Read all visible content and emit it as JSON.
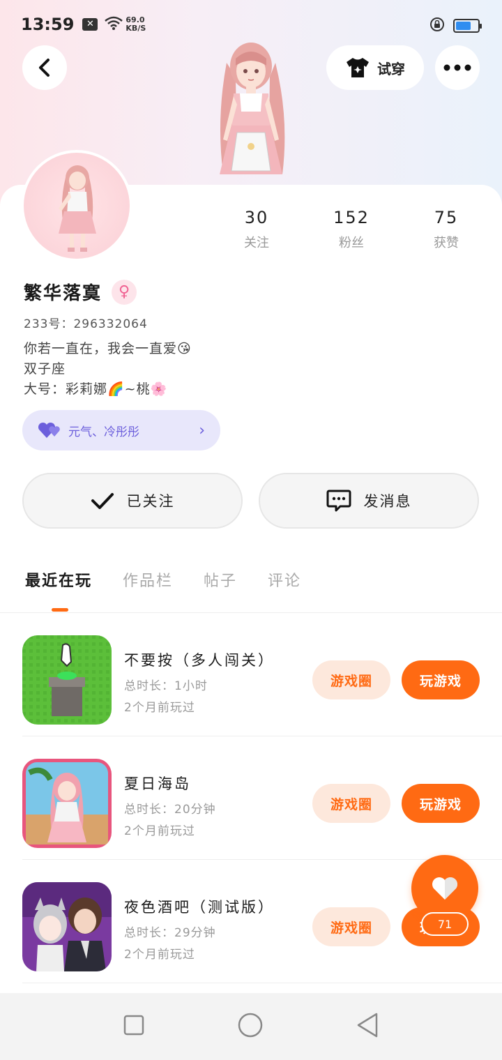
{
  "status_bar": {
    "time": "13:59",
    "notification_icon": "x-box-icon",
    "speed_value": "69.0",
    "speed_unit": "KB/S",
    "battery_level": 0.7,
    "battery_color": "#2f8df0"
  },
  "header": {
    "try_on_label": "试穿"
  },
  "profile": {
    "stats": [
      {
        "value": "30",
        "label": "关注"
      },
      {
        "value": "152",
        "label": "粉丝"
      },
      {
        "value": "75",
        "label": "获赞"
      }
    ],
    "username": "繁华落寞",
    "gender_symbol": "♀",
    "uid": "233号：296332064",
    "bio_lines": [
      "你若一直在，我会一直爱😘",
      "双子座",
      "大号：彩莉娜🌈~桃🌸"
    ],
    "tag_label": "元气、冷彤彤"
  },
  "actions": {
    "follow_label": "已关注",
    "message_label": "发消息"
  },
  "tabs": [
    "最近在玩",
    "作品栏",
    "帖子",
    "评论"
  ],
  "games": [
    {
      "title": "不要按（多人闯关）",
      "duration": "总时长：1小时",
      "last_played": "2个月前玩过",
      "circle_label": "游戏圈",
      "play_label": "玩游戏"
    },
    {
      "title": "夏日海岛",
      "duration": "总时长：20分钟",
      "last_played": "2个月前玩过",
      "circle_label": "游戏圈",
      "play_label": "玩游戏"
    },
    {
      "title": "夜色酒吧（测试版）",
      "duration": "总时长：29分钟",
      "last_played": "2个月前玩过",
      "circle_label": "游戏圈",
      "play_label": "玩游戏"
    }
  ],
  "like_fab": {
    "count": "71"
  },
  "colors": {
    "accent": "#ff6a13",
    "tag_bg": "#e8e7fb",
    "tag_text": "#6c5fdc"
  }
}
